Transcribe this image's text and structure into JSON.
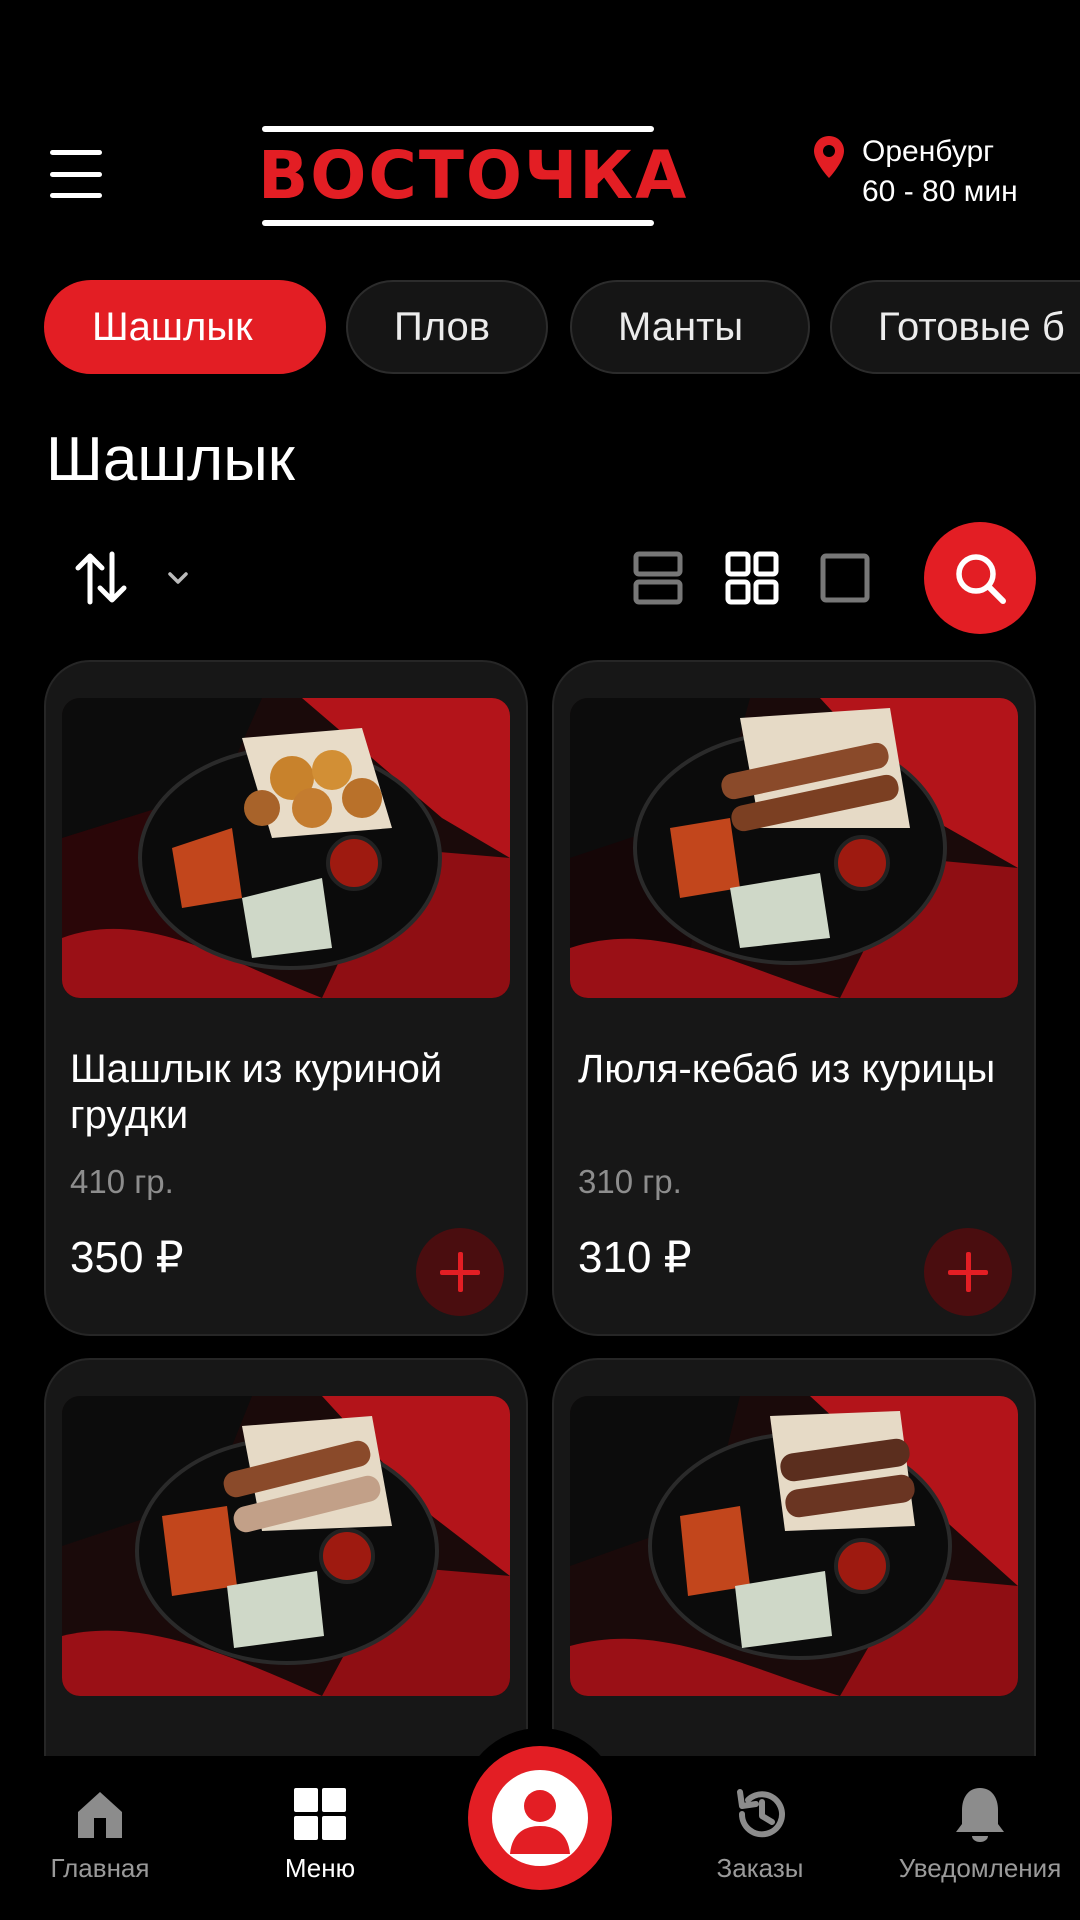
{
  "header": {
    "menu_icon": "hamburger-menu-icon",
    "logo_text": "ВОСТОЧКА",
    "city": "Оренбург",
    "delivery_time": "60 - 80 мин",
    "location_icon": "map-pin-icon",
    "brand_color": "#e31e24"
  },
  "categories": [
    {
      "label": "Шашлык",
      "active": true
    },
    {
      "label": "Плов",
      "active": false
    },
    {
      "label": "Манты",
      "active": false
    },
    {
      "label": "Готовые б",
      "active": false
    }
  ],
  "page_title": "Шашлык",
  "toolbar": {
    "sort_icon": "sort-arrows-icon",
    "dropdown_icon": "chevron-down-icon",
    "views": [
      "list-view-icon",
      "grid-view-icon",
      "single-view-icon"
    ],
    "active_view": "grid-view-icon",
    "search_icon": "search-icon"
  },
  "products": [
    {
      "name": "Шашлык из куриной грудки",
      "weight": "410 гр.",
      "price": "350 ₽"
    },
    {
      "name": "Люля-кебаб из курицы",
      "weight": "310 гр.",
      "price": "310 ₽"
    },
    {
      "name": "",
      "weight": "",
      "price": ""
    },
    {
      "name": "",
      "weight": "",
      "price": ""
    }
  ],
  "bottom_nav": {
    "items": [
      {
        "label": "Главная",
        "icon": "home-icon",
        "active": false
      },
      {
        "label": "Меню",
        "icon": "grid-menu-icon",
        "active": true
      },
      {
        "label": "Заказы",
        "icon": "history-icon",
        "active": false
      },
      {
        "label": "Уведомления",
        "icon": "bell-icon",
        "active": false
      }
    ],
    "center_icon": "profile-icon"
  }
}
